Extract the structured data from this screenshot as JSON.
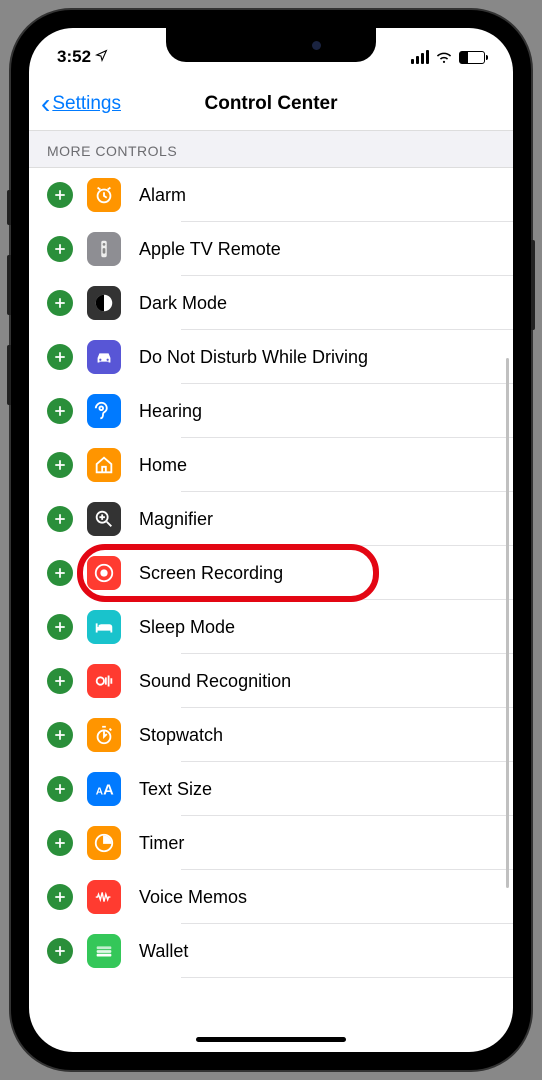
{
  "status": {
    "time": "3:52",
    "location_arrow": "➤"
  },
  "nav": {
    "back_label": "Settings",
    "title": "Control Center"
  },
  "section": {
    "header": "MORE CONTROLS"
  },
  "controls": [
    {
      "label": "Alarm",
      "icon": "alarm",
      "bg": "bg-orange",
      "highlighted": false
    },
    {
      "label": "Apple TV Remote",
      "icon": "remote",
      "bg": "bg-gray",
      "highlighted": false
    },
    {
      "label": "Dark Mode",
      "icon": "darkmode",
      "bg": "bg-darkgray",
      "highlighted": false
    },
    {
      "label": "Do Not Disturb While Driving",
      "icon": "car",
      "bg": "bg-purple",
      "highlighted": false
    },
    {
      "label": "Hearing",
      "icon": "ear",
      "bg": "bg-blue",
      "highlighted": false
    },
    {
      "label": "Home",
      "icon": "home",
      "bg": "bg-orange",
      "highlighted": false
    },
    {
      "label": "Magnifier",
      "icon": "magnifier",
      "bg": "bg-darkgray",
      "highlighted": false
    },
    {
      "label": "Screen Recording",
      "icon": "record",
      "bg": "bg-red",
      "highlighted": true
    },
    {
      "label": "Sleep Mode",
      "icon": "bed",
      "bg": "bg-cyan",
      "highlighted": false
    },
    {
      "label": "Sound Recognition",
      "icon": "sound",
      "bg": "bg-red",
      "highlighted": false
    },
    {
      "label": "Stopwatch",
      "icon": "stopwatch",
      "bg": "bg-orange",
      "highlighted": false
    },
    {
      "label": "Text Size",
      "icon": "textsize",
      "bg": "bg-blue",
      "highlighted": false
    },
    {
      "label": "Timer",
      "icon": "timer",
      "bg": "bg-orange",
      "highlighted": false
    },
    {
      "label": "Voice Memos",
      "icon": "voice",
      "bg": "bg-red",
      "highlighted": false
    },
    {
      "label": "Wallet",
      "icon": "wallet",
      "bg": "bg-green",
      "highlighted": false
    }
  ]
}
